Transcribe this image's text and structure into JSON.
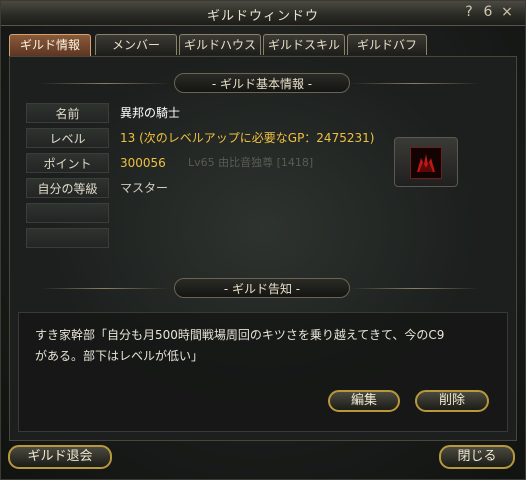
{
  "window": {
    "title": "ギルドウィンドウ",
    "help_label": "?",
    "icon_label": "6",
    "close_label": "×"
  },
  "tabs": [
    {
      "label": "ギルド情報",
      "active": true
    },
    {
      "label": "メンバー",
      "active": false
    },
    {
      "label": "ギルドハウス",
      "active": false
    },
    {
      "label": "ギルドスキル",
      "active": false
    },
    {
      "label": "ギルドバフ",
      "active": false
    }
  ],
  "basic_info": {
    "header": "- ギルド基本情報 -",
    "rows": [
      {
        "label": "名前",
        "value": "異邦の騎士"
      },
      {
        "label": "レベル",
        "value": "13 (次のレベルアップに必要なGP：2475231)"
      },
      {
        "label": "ポイント",
        "value": "300056"
      },
      {
        "label": "自分の等級",
        "value": "マスター"
      }
    ],
    "background_text": "Lv65 由比音独尊 [1418]"
  },
  "notice": {
    "header": "- ギルド告知 -",
    "text": "すき家幹部「自分も月500時間戦場周回のキツさを乗り越えてきて、今のC9\nがある。部下はレベルが低い」",
    "edit_label": "編集",
    "delete_label": "削除"
  },
  "footer": {
    "leave_label": "ギルド退会",
    "close_label": "閉じる"
  },
  "colors": {
    "accent_gold": "#b8983a",
    "value_yellow": "#f0c040",
    "active_tab": "#8a5a3a"
  }
}
